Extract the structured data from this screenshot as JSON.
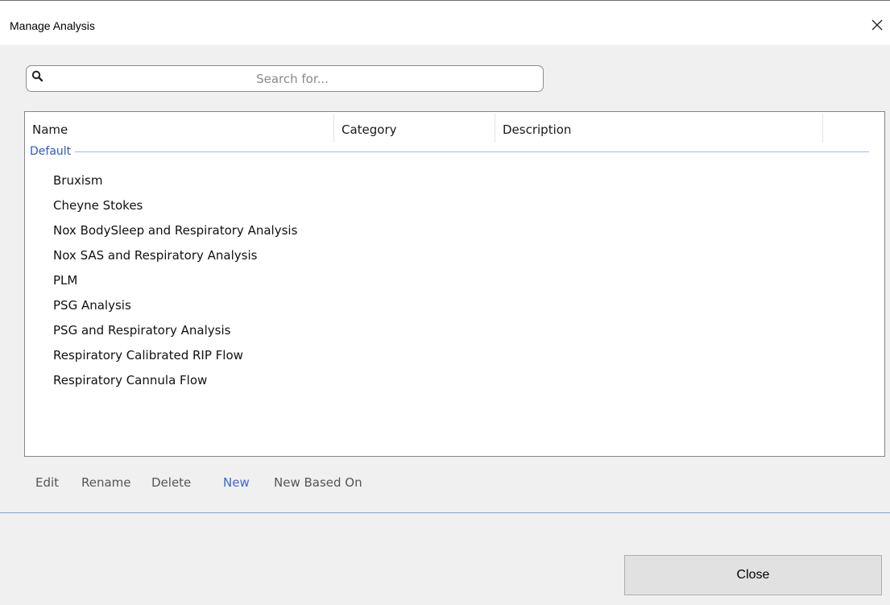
{
  "window": {
    "title": "Manage Analysis"
  },
  "search": {
    "placeholder": "Search for...",
    "value": ""
  },
  "table": {
    "columns": [
      "Name",
      "Category",
      "Description"
    ],
    "group": "Default",
    "rows": [
      "Bruxism",
      "Cheyne Stokes",
      "Nox BodySleep and Respiratory Analysis",
      "Nox SAS and Respiratory Analysis",
      "PLM",
      "PSG Analysis",
      "PSG and Respiratory Analysis",
      "Respiratory Calibrated RIP Flow",
      "Respiratory Cannula Flow"
    ]
  },
  "actions": {
    "edit": "Edit",
    "rename": "Rename",
    "delete": "Delete",
    "new": "New",
    "new_based_on": "New Based On"
  },
  "footer": {
    "close_label": "Close"
  },
  "colors": {
    "link": "#3a66d9",
    "group_label": "#2b59c3",
    "divider": "#7aa4e0"
  },
  "icons": {
    "search": "search-icon",
    "close": "close-icon"
  }
}
